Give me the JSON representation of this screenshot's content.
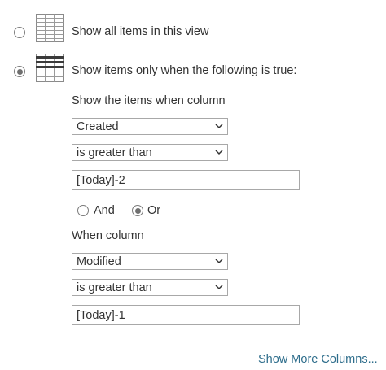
{
  "filter": {
    "option_all": {
      "label": "Show all items in this view",
      "selected": false
    },
    "option_conditional": {
      "label": "Show items only when the following is true:",
      "selected": true
    },
    "condition1": {
      "heading": "Show the items when column",
      "column": "Created",
      "operator": "is greater than",
      "value": "[Today]-2"
    },
    "conjunction": {
      "and_label": "And",
      "or_label": "Or",
      "selected": "Or"
    },
    "condition2": {
      "heading": "When column",
      "column": "Modified",
      "operator": "is greater than",
      "value": "[Today]-1"
    },
    "show_more_link": "Show More Columns..."
  },
  "colors": {
    "text": "#333333",
    "link": "#2f6e8c",
    "border": "#a8a8a8",
    "radio_dot": "#6f6f6f"
  },
  "icons": {
    "all_items": "table-grid-icon",
    "filtered_items": "table-filter-icon"
  }
}
